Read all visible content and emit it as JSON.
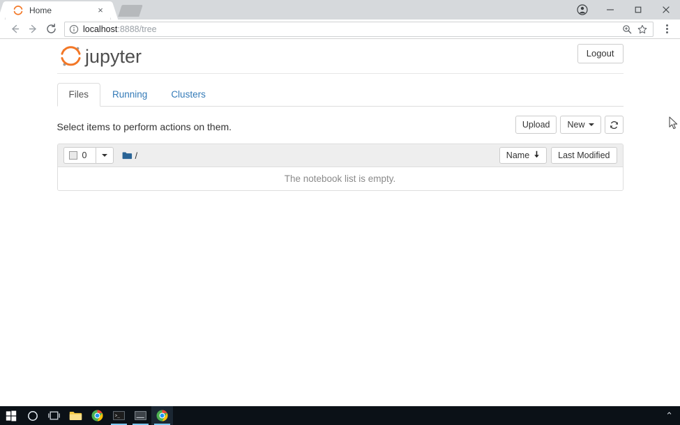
{
  "browser": {
    "tab": {
      "title": "Home",
      "favicon_name": "jupyter-favicon",
      "close_label": "×"
    },
    "new_tab_label": "",
    "window_controls": {
      "profile": "●",
      "minimize": "—",
      "maximize": "❐",
      "close": "✕"
    },
    "nav": {
      "back": "←",
      "forward": "→",
      "reload": "⟳"
    },
    "omnibox": {
      "info_icon": "info-icon",
      "url_host": "localhost",
      "url_rest": ":8888/tree",
      "zoom_icon": "zoom-search-icon",
      "star_icon": "☆"
    },
    "menu_label": "⋮"
  },
  "jupyter": {
    "logo_text": "jupyter",
    "logout_label": "Logout",
    "tabs": [
      {
        "label": "Files",
        "active": true
      },
      {
        "label": "Running",
        "active": false
      },
      {
        "label": "Clusters",
        "active": false
      }
    ],
    "action_text": "Select items to perform actions on them.",
    "buttons": {
      "upload": "Upload",
      "new": "New",
      "refresh_icon": "refresh-icon"
    },
    "list_header": {
      "selected_count": "0",
      "breadcrumb_root": "/",
      "folder_icon": "folder-icon",
      "sort_name": "Name",
      "sort_name_arrow": "↓",
      "sort_last_modified": "Last Modified"
    },
    "empty_message": "The notebook list is empty."
  },
  "taskbar": {
    "items": [
      {
        "name": "start-button",
        "icon": "windows-logo"
      },
      {
        "name": "cortana-button",
        "icon": "circle"
      },
      {
        "name": "task-view-button",
        "icon": "task-view"
      },
      {
        "name": "file-explorer",
        "icon": "folder"
      },
      {
        "name": "chrome-pinned",
        "icon": "chrome"
      },
      {
        "name": "terminal-1",
        "icon": "console-dark"
      },
      {
        "name": "terminal-2",
        "icon": "console-gray"
      },
      {
        "name": "chrome-active",
        "icon": "chrome"
      }
    ],
    "tray_chevron": "⌃"
  },
  "colors": {
    "jupyter_orange": "#f37726",
    "jupyter_gray": "#4e4e4e",
    "link_blue": "#337ab7",
    "folder_blue": "#2a6496",
    "taskbar_bg": "#0b1117",
    "accent_underline": "#7ec8f0"
  }
}
